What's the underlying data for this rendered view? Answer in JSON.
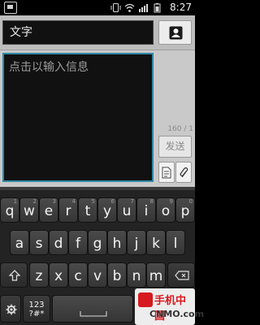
{
  "status_bar": {
    "time": "8:27",
    "icons": [
      "sim-icon",
      "vibrate-icon",
      "wifi-icon",
      "signal-icon",
      "battery-icon"
    ]
  },
  "compose": {
    "recipient_value": "文字",
    "message_placeholder": "点击以输入信息",
    "char_counter": "160 / 1",
    "send_label": "发送",
    "buttons": [
      "contact-icon",
      "template-icon",
      "attach-icon"
    ]
  },
  "keyboard": {
    "row1": [
      {
        "label": "q",
        "hint": "1"
      },
      {
        "label": "w",
        "hint": "2"
      },
      {
        "label": "e",
        "hint": "3"
      },
      {
        "label": "r",
        "hint": "4"
      },
      {
        "label": "t",
        "hint": "5"
      },
      {
        "label": "y",
        "hint": "6"
      },
      {
        "label": "u",
        "hint": "7"
      },
      {
        "label": "i",
        "hint": "8"
      },
      {
        "label": "o",
        "hint": "9"
      },
      {
        "label": "p",
        "hint": "0"
      }
    ],
    "row2": [
      "a",
      "s",
      "d",
      "f",
      "g",
      "h",
      "j",
      "k",
      "l"
    ],
    "row3": [
      "z",
      "x",
      "c",
      "v",
      "b",
      "n",
      "m"
    ],
    "symbols_label": "123\n?#*",
    "settings_icon": "gear-icon",
    "shift_icon": "shift-icon",
    "delete_icon": "backspace-icon",
    "space_icon": "space-icon"
  },
  "watermark": {
    "brand_cn": "手机中国",
    "brand_en": "CNMO.com"
  }
}
